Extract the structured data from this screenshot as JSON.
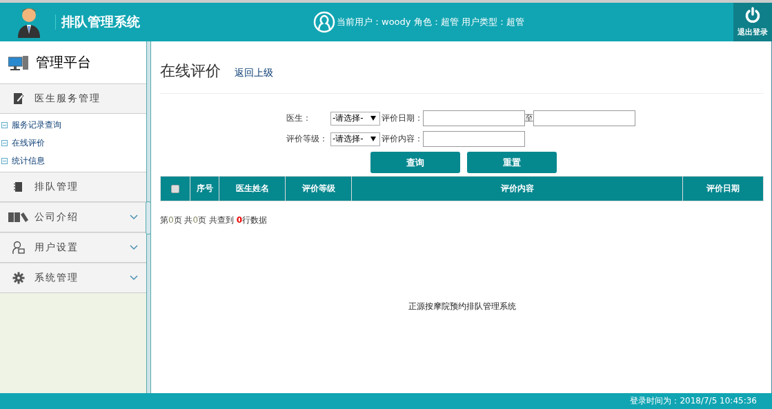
{
  "header": {
    "title": "排队管理系统",
    "user_info": "当前用户：woody 角色：超管 用户类型：超管",
    "logout": "退出登录"
  },
  "sidebar": {
    "title": "管理平台",
    "sections": [
      {
        "label": "医生服务管理",
        "kind": "notebook",
        "expanded": true,
        "chevron": false,
        "children": [
          {
            "label": "服务记录查询"
          },
          {
            "label": "在线评价"
          },
          {
            "label": "统计信息"
          }
        ]
      },
      {
        "label": "排队管理",
        "kind": "book",
        "expanded": false,
        "chevron": false
      },
      {
        "label": "公司介绍",
        "kind": "binders",
        "expanded": false,
        "chevron": true
      },
      {
        "label": "用户设置",
        "kind": "user",
        "expanded": false,
        "chevron": true
      },
      {
        "label": "系统管理",
        "kind": "gear",
        "expanded": false,
        "chevron": true
      }
    ]
  },
  "page": {
    "title": "在线评价",
    "back_link": "返回上级"
  },
  "filters": {
    "doctor_label": "医生：",
    "doctor_select": "-请选择-",
    "date_label": "评价日期：",
    "date_to": "至",
    "level_label": "评价等级：",
    "level_select": "-请选择-",
    "content_label": "评价内容：",
    "buttons": [
      "查询",
      "重置"
    ]
  },
  "table": {
    "select_all": {
      "checked": false
    },
    "columns": [
      "序号",
      "医生姓名",
      "评价等级",
      "评价内容",
      "评价日期"
    ]
  },
  "pager": [
    {
      "text": "第",
      "highlight": false
    },
    {
      "text": "0",
      "highlight": false
    },
    {
      "text": "页 共",
      "highlight": false
    },
    {
      "text": "0",
      "highlight": false
    },
    {
      "text": "页 共查到 ",
      "highlight": false
    },
    {
      "text": "0",
      "highlight": true
    },
    {
      "text": "行数据",
      "highlight": false
    }
  ],
  "footer_note": "正源按摩院预约排队管理系统",
  "status_bar": {
    "login_time": "登录时间为：2018/7/5 10:45:36"
  }
}
